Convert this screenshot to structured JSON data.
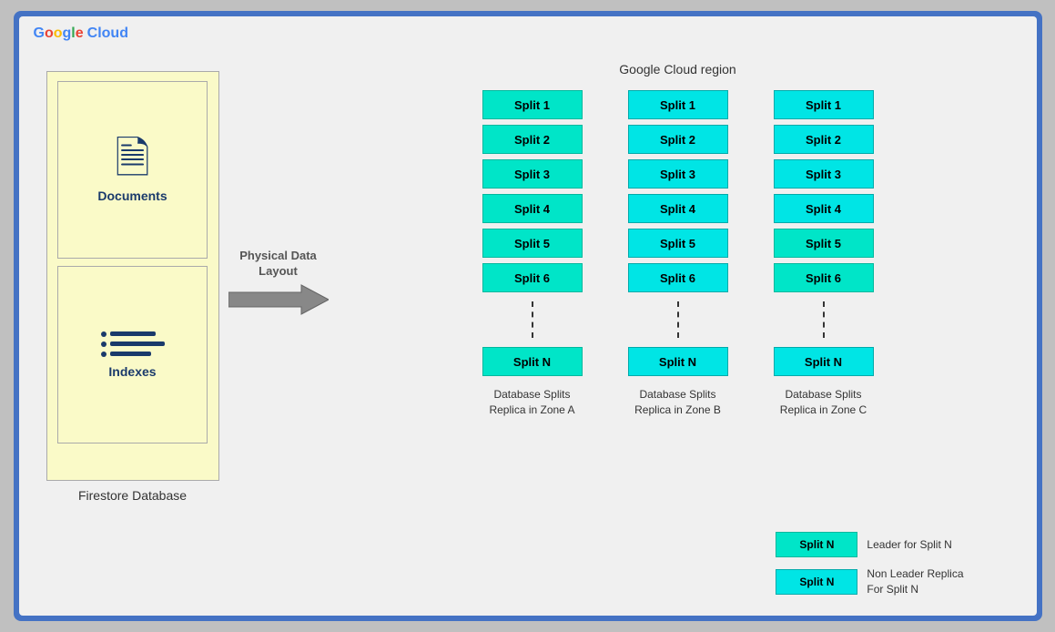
{
  "logo": {
    "google": "Google",
    "cloud": "Cloud"
  },
  "region": {
    "label": "Google Cloud region"
  },
  "firestore": {
    "label": "Firestore Database",
    "documents_label": "Documents",
    "indexes_label": "Indexes"
  },
  "arrow": {
    "label": "Physical Data\nLayout"
  },
  "zones": [
    {
      "name": "Database Splits\nReplica in Zone A",
      "splits": [
        "Split 1",
        "Split 2",
        "Split 3",
        "Split 4",
        "Split 5",
        "Split 6",
        "Split N"
      ],
      "types": [
        "green",
        "green",
        "green",
        "green",
        "green",
        "green",
        "green"
      ]
    },
    {
      "name": "Database Splits\nReplica in Zone B",
      "splits": [
        "Split 1",
        "Split 2",
        "Split 3",
        "Split 4",
        "Split 5",
        "Split 6",
        "Split N"
      ],
      "types": [
        "cyan",
        "cyan",
        "cyan",
        "cyan",
        "cyan",
        "cyan",
        "cyan"
      ]
    },
    {
      "name": "Database Splits\nReplica in Zone C",
      "splits": [
        "Split 1",
        "Split 2",
        "Split 3",
        "Split 4",
        "Split 5",
        "Split 6",
        "Split N"
      ],
      "types": [
        "cyan",
        "cyan",
        "cyan",
        "green",
        "green",
        "green",
        "cyan"
      ]
    }
  ],
  "legend": [
    {
      "label": "Split N",
      "type": "green",
      "text": "Leader for Split N"
    },
    {
      "label": "Split N",
      "type": "cyan",
      "text": "Non Leader Replica\nFor Split N"
    }
  ]
}
